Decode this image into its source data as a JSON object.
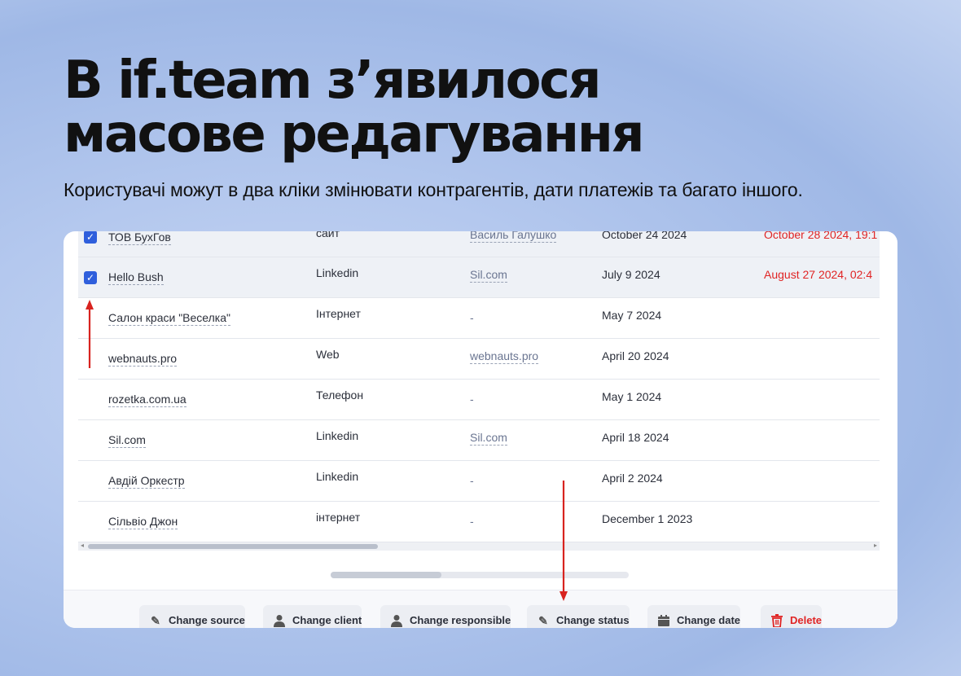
{
  "headline": {
    "line1": "В if.team з’явилося",
    "line2": "масове редагування"
  },
  "subtitle": "Користувачі можут в два кліки змінювати контрагентів, дати платежів та багато іншого.",
  "table": {
    "rows": [
      {
        "name": "ТОВ БухГов",
        "source": "сайт",
        "responsible": "Василь Галушко",
        "date": "October 24 2024",
        "due": "October 28 2024, 19:1",
        "checked": true
      },
      {
        "name": "Hello Bush",
        "source": "Linkedin",
        "responsible": "Sil.com",
        "date": "July 9 2024",
        "due": "August 27 2024, 02:4",
        "checked": true
      },
      {
        "name": "Салон краси \"Веселка\"",
        "source": "Інтернет",
        "responsible": "-",
        "date": "May 7 2024",
        "due": "",
        "checked": false
      },
      {
        "name": "webnauts.pro",
        "source": "Web",
        "responsible": "webnauts.pro",
        "date": "April 20 2024",
        "due": "",
        "checked": false
      },
      {
        "name": "rozetka.com.ua",
        "source": "Телефон",
        "responsible": "-",
        "date": "May 1 2024",
        "due": "",
        "checked": false
      },
      {
        "name": "Sil.com",
        "source": "Linkedin",
        "responsible": "Sil.com",
        "date": "April 18 2024",
        "due": "",
        "checked": false
      },
      {
        "name": "Авдій Оркестр",
        "source": "Linkedin",
        "responsible": "-",
        "date": "April 2 2024",
        "due": "",
        "checked": false
      },
      {
        "name": "Сільвіо Джон",
        "source": "інтернет",
        "responsible": "-",
        "date": "December 1 2023",
        "due": "",
        "checked": false
      }
    ]
  },
  "actions": [
    {
      "label": "Change source",
      "icon": "pencil-icon"
    },
    {
      "label": "Change client",
      "icon": "person-icon"
    },
    {
      "label": "Change responsible",
      "icon": "person-icon"
    },
    {
      "label": "Change status",
      "icon": "pencil-icon"
    },
    {
      "label": "Change date",
      "icon": "calendar-icon"
    },
    {
      "label": "Delete",
      "icon": "trash-icon"
    }
  ],
  "colors": {
    "accent": "#2f5fdc",
    "danger": "#e02424",
    "annotation_arrow": "#d8231f"
  }
}
